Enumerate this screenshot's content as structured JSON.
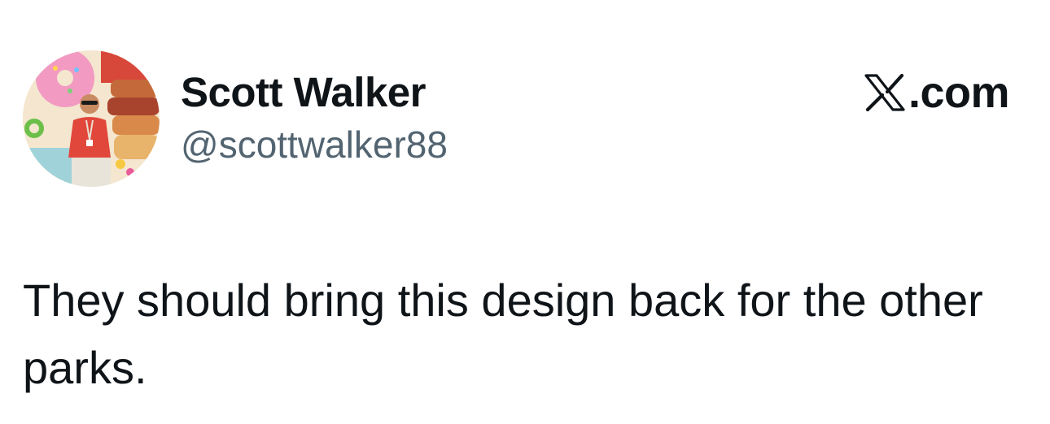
{
  "author": {
    "display_name": "Scott Walker",
    "handle": "@scottwalker88"
  },
  "brand": {
    "logo_icon": "x-logo-icon",
    "suffix": ".com"
  },
  "tweet": {
    "text": "They should bring this design back for the other parks."
  },
  "colors": {
    "text_primary": "#0f1419",
    "text_secondary": "#536471",
    "background": "#ffffff"
  }
}
